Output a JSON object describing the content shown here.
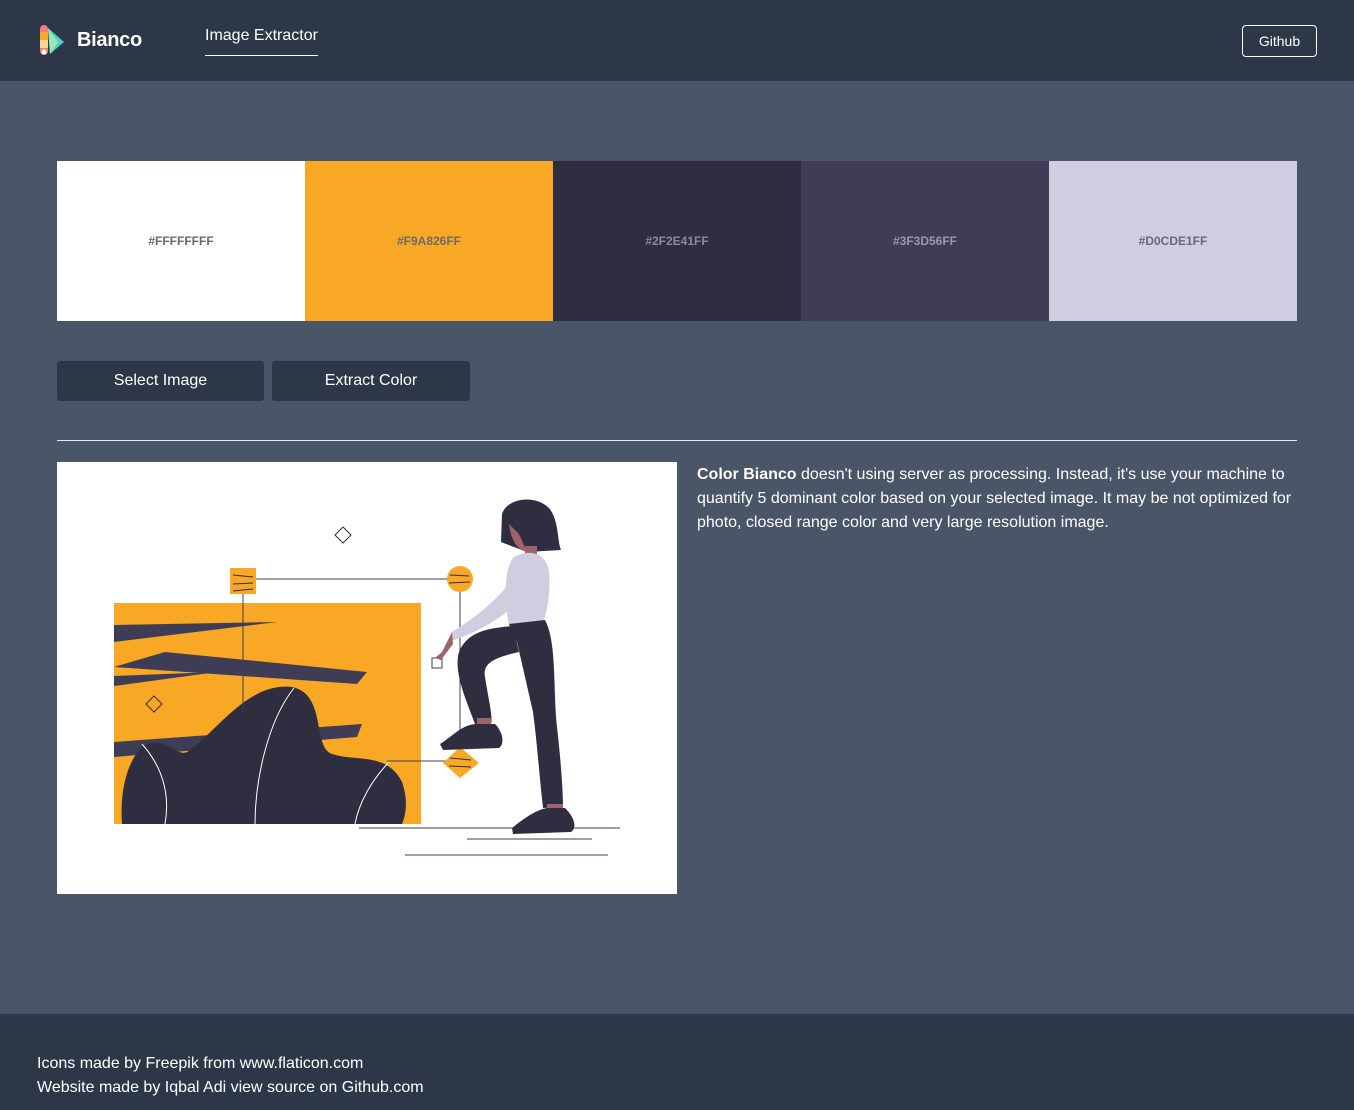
{
  "header": {
    "brand": "Bianco",
    "nav_link": "Image Extractor",
    "github_label": "Github"
  },
  "palette": [
    {
      "label": "#FFFFFFFF",
      "color": "#ffffff"
    },
    {
      "label": "#F9A826FF",
      "color": "#f9a826"
    },
    {
      "label": "#2F2E41FF",
      "color": "#2f2e41"
    },
    {
      "label": "#3F3D56FF",
      "color": "#3f3d56"
    },
    {
      "label": "#D0CDE1FF",
      "color": "#d0cde1"
    }
  ],
  "actions": {
    "select_label": "Select Image",
    "extract_label": "Extract Color"
  },
  "description": {
    "strong": "Color Bianco",
    "text": " doesn't using server as processing. Instead, it's use your machine to quantify 5 dominant color based on your selected image. It may be not optimized for photo, closed range color and very large resolution image."
  },
  "footer": {
    "line1": "Icons made by Freepik from www.flaticon.com",
    "line2": "Website made by Iqbal Adi view source on Github.com"
  },
  "colors": {
    "navbar": "#2d3748",
    "background": "#4a5568",
    "accent": "#f9a826",
    "dark": "#2f2e41",
    "lavender": "#d0cde1"
  },
  "icons": {
    "logo": "color-palette-logo"
  }
}
